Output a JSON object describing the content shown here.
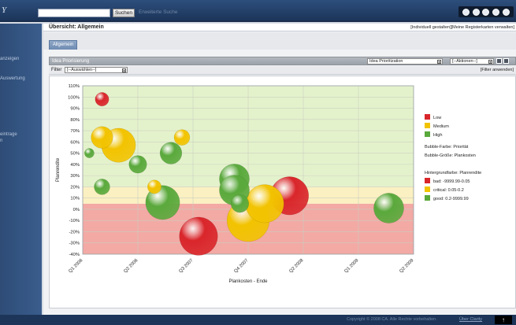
{
  "topbar": {
    "logo": "Y",
    "search_placeholder": "",
    "search_button": "Suchen",
    "advanced_search": "Erweiterte Suche",
    "icons": [
      "help-icon",
      "print-icon",
      "settings-icon",
      "user-icon",
      "logout-icon"
    ]
  },
  "sidebar": {
    "items": [
      "anzeigen",
      "Auswertung",
      "",
      "eintrage",
      "n",
      "...",
      ""
    ]
  },
  "header": {
    "title": "Übersicht: Allgemein",
    "right_link": "[Individuell gestalten][Meine Registerkarten verwalten]"
  },
  "tabs": [
    {
      "label": "Allgemein"
    }
  ],
  "panel": {
    "title": "Idea Priorisierung",
    "view_select": "Idea Prioritization",
    "actions_select": "[--Aktionen--]",
    "filter_label": "Filter",
    "filter_value": "[--Auswählen--]",
    "filter_apply": "[Filter anwenden]"
  },
  "colors": {
    "low": "#d9262b",
    "medium": "#f2c300",
    "high": "#5aa93c",
    "band_bad": "#f3a9a4",
    "band_critical": "#fbf0c2",
    "band_good": "#e4f2cc"
  },
  "chart_data": {
    "type": "scatter",
    "subtype": "bubble",
    "xlabel": "Plankosten - Ende",
    "ylabel": "Planrendite",
    "x_ticks": [
      "Q1 2006",
      "Q2 2006",
      "Q3 2007",
      "Q4 2007",
      "Q2 2008",
      "Q1 2009",
      "Q2 2009"
    ],
    "y_ticks": [
      "110%",
      "100%",
      "90%",
      "80%",
      "70%",
      "60%",
      "50%",
      "40%",
      "30%",
      "20%",
      "10%",
      "0%",
      "-10%",
      "-20%",
      "-30%",
      "-40%"
    ],
    "ylim": [
      -40,
      110
    ],
    "grid": true,
    "legend_position": "right",
    "legend": {
      "priority_items": [
        "Low",
        "Medium",
        "High"
      ],
      "bubble_color_note": "Bubble-Farbe: Priorität",
      "bubble_size_note": "Bubble-Größe: Plankosten",
      "background_title": "Hintergrundfarbe: Planrendite",
      "background_items": [
        "bad: -9999.99-0.05",
        "critical: 0.05-0.2",
        "good: 0.2-9999.99"
      ]
    },
    "bands": [
      {
        "name": "bad",
        "from": -40,
        "to": 5
      },
      {
        "name": "critical",
        "from": 5,
        "to": 20
      },
      {
        "name": "good",
        "from": 20,
        "to": 110
      }
    ],
    "series": [
      {
        "name": "Low",
        "points": [
          {
            "x": 0.35,
            "y": 98,
            "size": 2
          },
          {
            "x": 2.1,
            "y": -24,
            "size": 8
          },
          {
            "x": 3.75,
            "y": 12,
            "size": 8
          }
        ]
      },
      {
        "name": "Medium",
        "points": [
          {
            "x": 0.35,
            "y": 64,
            "size": 4
          },
          {
            "x": 0.65,
            "y": 57,
            "size": 7
          },
          {
            "x": 1.3,
            "y": 20,
            "size": 2
          },
          {
            "x": 1.8,
            "y": 64,
            "size": 2.5
          },
          {
            "x": 3.0,
            "y": -10,
            "size": 9
          },
          {
            "x": 3.3,
            "y": 5,
            "size": 8
          }
        ]
      },
      {
        "name": "High",
        "points": [
          {
            "x": 0.12,
            "y": 50,
            "size": 1
          },
          {
            "x": 0.35,
            "y": 20,
            "size": 2.5
          },
          {
            "x": 1.0,
            "y": 40,
            "size": 3
          },
          {
            "x": 1.6,
            "y": 50,
            "size": 4
          },
          {
            "x": 1.45,
            "y": 6,
            "size": 7
          },
          {
            "x": 2.75,
            "y": 27,
            "size": 6
          },
          {
            "x": 2.75,
            "y": 17,
            "size": 6
          },
          {
            "x": 2.85,
            "y": 5,
            "size": 3
          },
          {
            "x": 5.55,
            "y": 1,
            "size": 6
          }
        ]
      }
    ]
  },
  "status": {
    "copyright": "Copyright © 2008 CA. Alle Rechte vorbehalten.",
    "link": "Über Clarity",
    "up_icon": "up-arrow-icon"
  }
}
